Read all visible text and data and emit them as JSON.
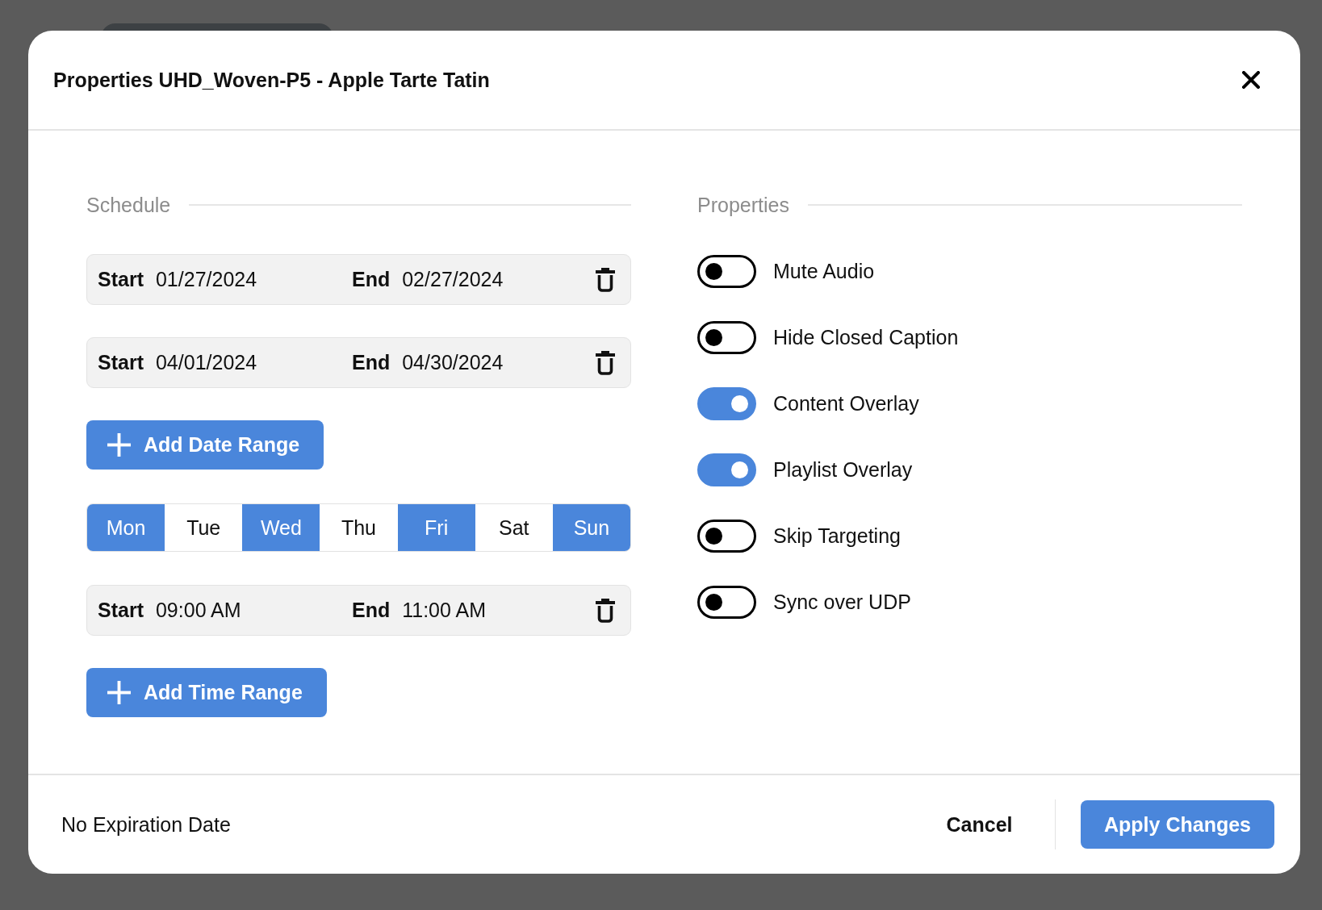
{
  "dialog": {
    "title": "Properties UHD_Woven-P5 - Apple Tarte Tatin"
  },
  "schedule": {
    "heading": "Schedule",
    "date_ranges": [
      {
        "start_label": "Start",
        "start": "01/27/2024",
        "end_label": "End",
        "end": "02/27/2024"
      },
      {
        "start_label": "Start",
        "start": "04/01/2024",
        "end_label": "End",
        "end": "04/30/2024"
      }
    ],
    "add_date_range_button": "Add Date Range",
    "days": [
      {
        "label": "Mon",
        "selected": true
      },
      {
        "label": "Tue",
        "selected": false
      },
      {
        "label": "Wed",
        "selected": true
      },
      {
        "label": "Thu",
        "selected": false
      },
      {
        "label": "Fri",
        "selected": true
      },
      {
        "label": "Sat",
        "selected": false
      },
      {
        "label": "Sun",
        "selected": true
      }
    ],
    "time_ranges": [
      {
        "start_label": "Start",
        "start": "09:00 AM",
        "end_label": "End",
        "end": "11:00 AM"
      }
    ],
    "add_time_range_button": "Add Time Range"
  },
  "properties": {
    "heading": "Properties",
    "toggles": [
      {
        "label": "Mute Audio",
        "on": false
      },
      {
        "label": "Hide Closed Caption",
        "on": false
      },
      {
        "label": "Content Overlay",
        "on": true
      },
      {
        "label": "Playlist Overlay",
        "on": true
      },
      {
        "label": "Skip Targeting",
        "on": false
      },
      {
        "label": "Sync over UDP",
        "on": false
      }
    ]
  },
  "footer": {
    "expiration": "No Expiration Date",
    "cancel_button": "Cancel",
    "apply_button": "Apply Changes"
  }
}
